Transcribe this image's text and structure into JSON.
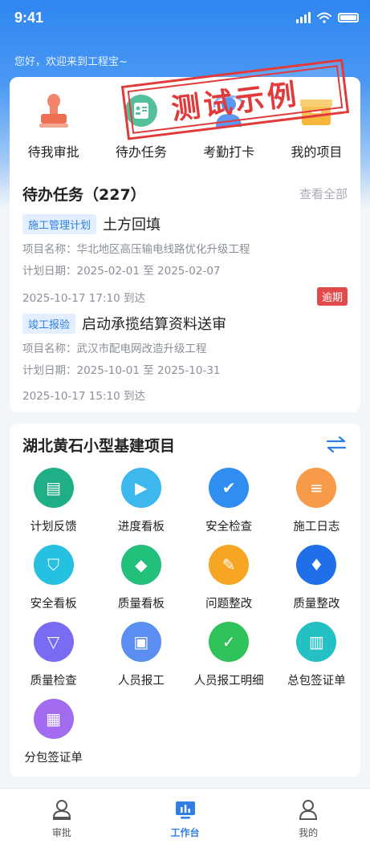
{
  "status": {
    "time": "9:41"
  },
  "header": {
    "greeting": "您好，欢迎来到工程宝~"
  },
  "stamp": {
    "text": "测试示例"
  },
  "quick_actions": [
    {
      "label": "待我审批",
      "icon": "stamp-icon"
    },
    {
      "label": "待办任务",
      "icon": "task-list-icon"
    },
    {
      "label": "考勤打卡",
      "icon": "attendance-icon"
    },
    {
      "label": "我的项目",
      "icon": "folder-icon"
    }
  ],
  "todo": {
    "title": "待办任务（227）",
    "view_all": "查看全部",
    "tasks": [
      {
        "tag": "施工管理计划",
        "title": "土方回填",
        "project": "项目名称：华北地区高压输电线路优化升级工程",
        "dates": "计划日期：2025-02-01 至 2025-02-07",
        "arrival": "2025-10-17 17:10  到达",
        "badge": "逾期"
      },
      {
        "tag": "竣工报验",
        "title": "启动承揽结算资料送审",
        "project": "项目名称：武汉市配电网改造升级工程",
        "dates": "计划日期：2025-10-01 至 2025-10-31",
        "arrival": "2025-10-17 15:10  到达",
        "badge": ""
      }
    ]
  },
  "project": {
    "title": "湖北黄石小型基建项目",
    "modules": [
      {
        "label": "计划反馈",
        "icon": "plan-feedback-icon",
        "color": "#1fae86"
      },
      {
        "label": "进度看板",
        "icon": "progress-board-icon",
        "color": "#3cb8ee"
      },
      {
        "label": "安全检查",
        "icon": "safety-check-icon",
        "color": "#2f8ef0"
      },
      {
        "label": "施工日志",
        "icon": "construction-log-icon",
        "color": "#f79a4a"
      },
      {
        "label": "安全看板",
        "icon": "safety-board-icon",
        "color": "#26c1e0"
      },
      {
        "label": "质量看板",
        "icon": "quality-board-icon",
        "color": "#22c07a"
      },
      {
        "label": "问题整改",
        "icon": "issue-fix-icon",
        "color": "#f7a623"
      },
      {
        "label": "质量整改",
        "icon": "quality-fix-icon",
        "color": "#1f6fe8"
      },
      {
        "label": "质量检查",
        "icon": "quality-check-icon",
        "color": "#7a6cf2"
      },
      {
        "label": "人员报工",
        "icon": "staff-report-icon",
        "color": "#5b8ef0"
      },
      {
        "label": "人员报工明细",
        "icon": "staff-report-detail-icon",
        "color": "#2fc25a"
      },
      {
        "label": "总包签证单",
        "icon": "general-visa-icon",
        "color": "#25c0c4"
      },
      {
        "label": "分包签证单",
        "icon": "sub-visa-icon",
        "color": "#a36cf0"
      }
    ]
  },
  "tabbar": [
    {
      "label": "审批",
      "icon": "approval-person-icon",
      "active": false
    },
    {
      "label": "工作台",
      "icon": "workbench-icon",
      "active": true
    },
    {
      "label": "我的",
      "icon": "profile-icon",
      "active": false
    }
  ],
  "colors": {
    "primary": "#2f7fe6",
    "danger": "#e14a4a",
    "stamp": "#e23a3a"
  }
}
